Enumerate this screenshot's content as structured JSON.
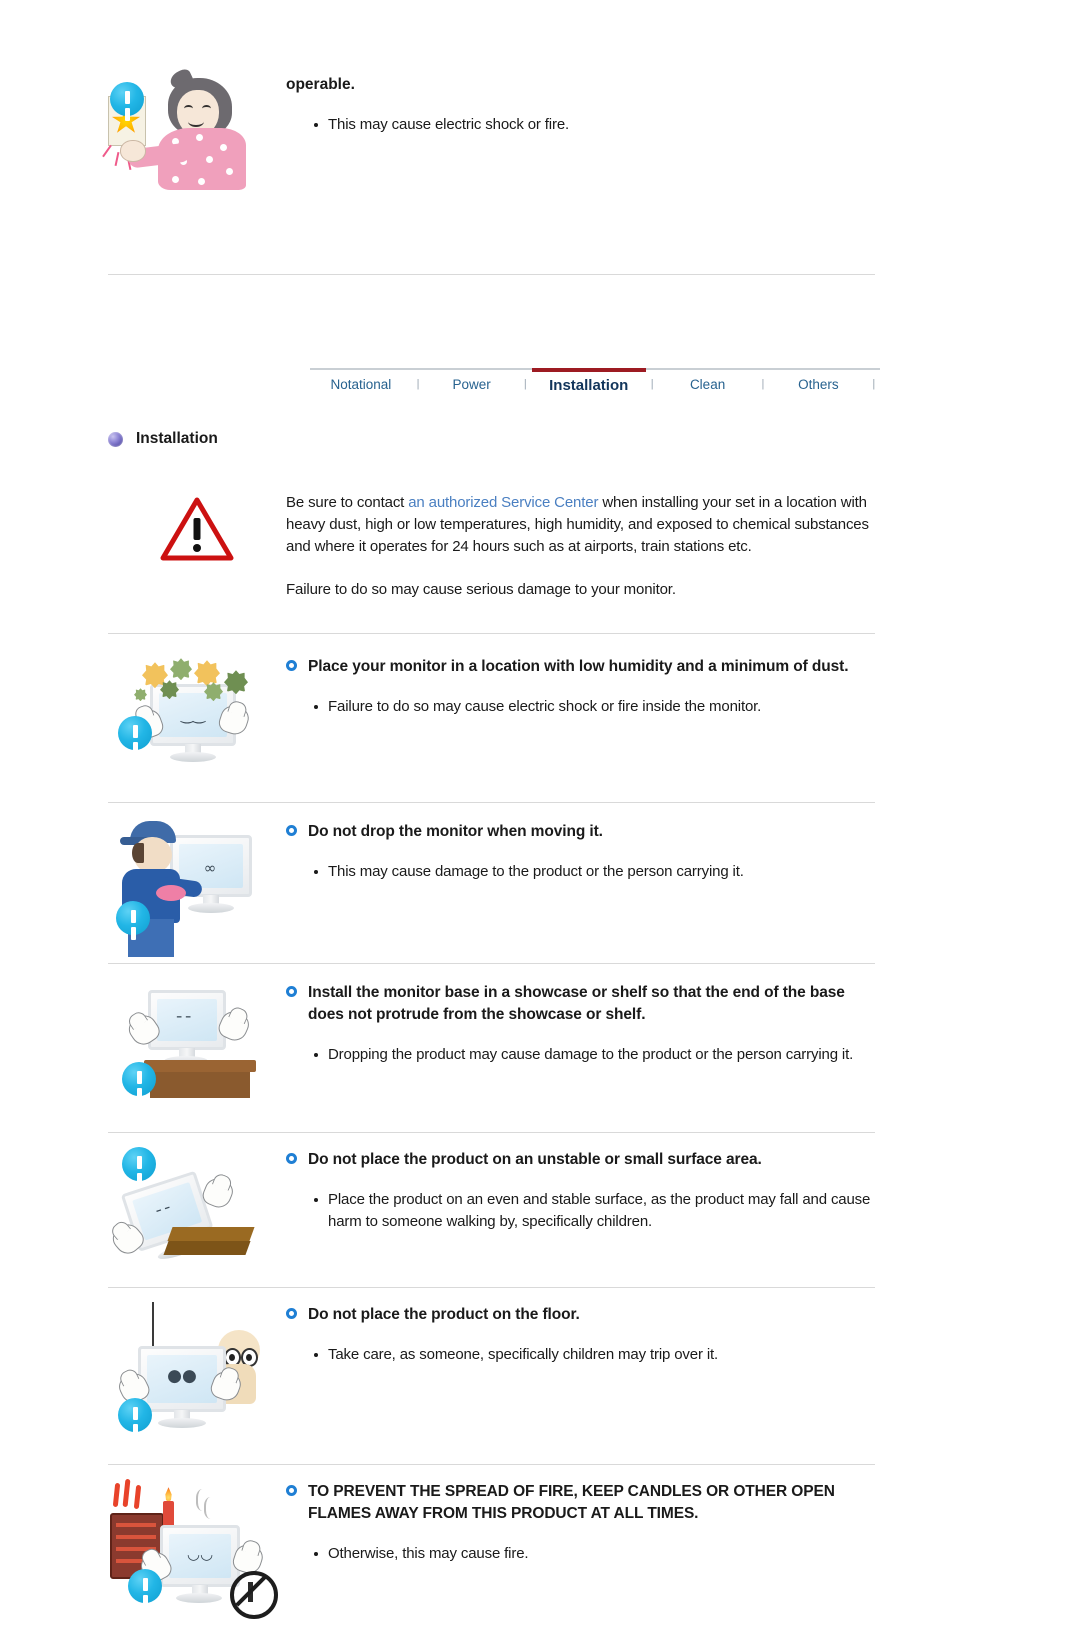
{
  "document": {
    "section_label": "Installation"
  },
  "top_section": {
    "heading": "operable.",
    "bullets": [
      "This may cause electric shock or fire."
    ],
    "art_name": "woman-plugging-outlet-illustration"
  },
  "tabs": {
    "items": [
      {
        "label": "Notational",
        "active": false
      },
      {
        "label": "Power",
        "active": false
      },
      {
        "label": "Installation",
        "active": true
      },
      {
        "label": "Clean",
        "active": false
      },
      {
        "label": "Others",
        "active": false
      }
    ],
    "separator": "|",
    "active_underline_color": "#9d1b22",
    "inactive_color": "#27628f",
    "active_color": "#12355b"
  },
  "intro": {
    "paragraph_before_link": "Be sure to contact ",
    "link_text": "an authorized Service Center",
    "paragraph_after_link": " when installing your set in a location with heavy dust, high or low temperatures, high humidity, and exposed to chemical substances and where it operates for 24 hours such as at airports, train stations etc.",
    "paragraph2": "Failure to do so may cause serious damage to your monitor.",
    "link_color": "#4a7fc1"
  },
  "sections": [
    {
      "heading": "Place your monitor in a location with low humidity and a minimum of dust.",
      "bullets": [
        "Failure to do so may cause electric shock or fire inside the monitor."
      ],
      "art_name": "monitor-with-dust-particles-illustration"
    },
    {
      "heading": "Do not drop the monitor when moving it.",
      "bullets": [
        "This may cause damage to the product or the person carrying it."
      ],
      "art_name": "man-carrying-monitor-illustration"
    },
    {
      "heading": "Install the monitor base in a showcase or shelf so that the end of the base does not protrude from the showcase or shelf.",
      "bullets": [
        "Dropping the product may cause damage to the product or the person carrying it."
      ],
      "art_name": "monitor-on-shelf-illustration"
    },
    {
      "heading": "Do not place the product on an unstable or small surface area.",
      "bullets": [
        "Place the product on an even and stable surface, as the product may fall and cause harm to someone walking by, specifically children."
      ],
      "art_name": "monitor-tipping-on-small-stand-illustration"
    },
    {
      "heading": "Do not place the product on the floor.",
      "bullets": [
        "Take care, as someone, specifically children may trip over it."
      ],
      "art_name": "monitor-on-floor-with-child-illustration"
    },
    {
      "heading": "TO PREVENT THE SPREAD OF FIRE, KEEP CANDLES OR OTHER OPEN FLAMES AWAY FROM THIS PRODUCT AT ALL TIMES.",
      "bullets": [
        "Otherwise, this may cause fire."
      ],
      "art_name": "monitor-near-fire-and-candle-illustration"
    }
  ],
  "icons": {
    "caution_badge": "blue-exclamation-badge-icon",
    "warning_triangle": "red-warning-triangle-icon",
    "section_sphere": "purple-sphere-bullet-icon",
    "heading_ring": "blue-ring-bullet-icon"
  },
  "colors": {
    "caution_badge": "#22b6e6",
    "warning_triangle": "#cc1111",
    "section_sphere": "#645cb4",
    "heading_ring": "#1f7fd4",
    "separator_line": "#d9d9d9"
  }
}
